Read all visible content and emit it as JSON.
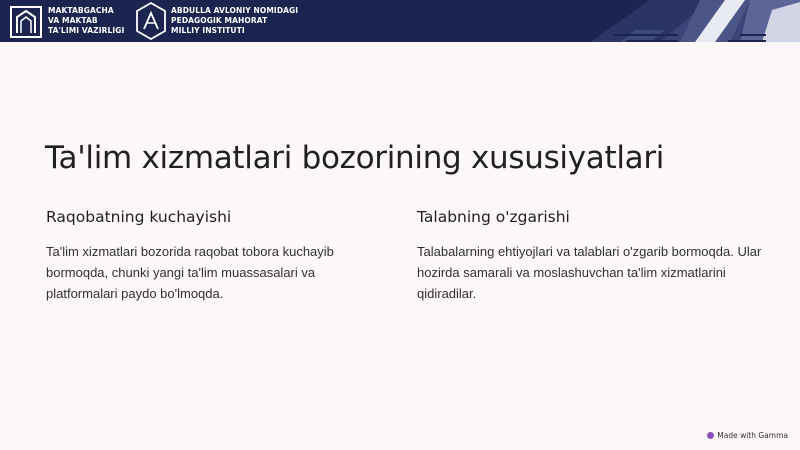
{
  "header": {
    "logo1_lines": [
      "MAKTABGACHA",
      "VA MAKTAB",
      "TA'LIMI VAZIRLIGI"
    ],
    "logo2_lines": [
      "ABDULLA AVLONIY NOMIDAGI",
      "PEDAGOGIK MAHORAT",
      "MILLIY INSTITUTI"
    ]
  },
  "slide": {
    "title": "Ta'lim xizmatlari bozorining xususiyatlari",
    "columns": [
      {
        "heading": "Raqobatning kuchayishi",
        "body": "Ta'lim xizmatlari bozorida raqobat tobora kuchayib bormoqda, chunki yangi ta'lim muassasalari va platformalari paydo bo'lmoqda."
      },
      {
        "heading": "Talabning o'zgarishi",
        "body": "Talabalarning ehtiyojlari va talablari o'zgarib bormoqda. Ular hozirda samarali va moslashuvchan ta'lim xizmatlarini qidiradilar."
      }
    ]
  },
  "badge": {
    "label": "Made with Gamma"
  },
  "colors": {
    "header_bg": "#1b2550",
    "page_bg": "#fdf8f8",
    "text": "#1f1f24"
  }
}
